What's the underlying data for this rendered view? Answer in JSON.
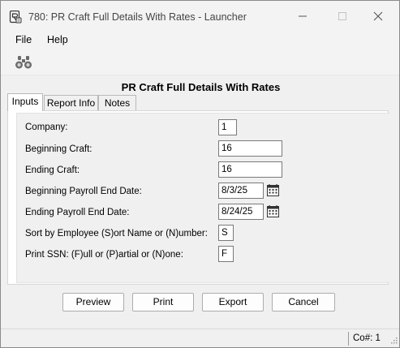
{
  "window": {
    "title": "780: PR Craft Full Details With Rates - Launcher",
    "app_icon": "app-icon"
  },
  "menu": {
    "file": "File",
    "help": "Help"
  },
  "toolbar": {
    "find_icon": "binoculars-icon"
  },
  "form": {
    "title": "PR Craft Full Details With Rates"
  },
  "tabs": [
    {
      "label": "Inputs",
      "active": true
    },
    {
      "label": "Report Info",
      "active": false
    },
    {
      "label": "Notes",
      "active": false
    }
  ],
  "fields": {
    "company": {
      "label": "Company:",
      "value": "1"
    },
    "beginning_craft": {
      "label": "Beginning Craft:",
      "value": "16"
    },
    "ending_craft": {
      "label": "Ending Craft:",
      "value": "16"
    },
    "beginning_payroll_end_date": {
      "label": "Beginning Payroll End Date:",
      "value": "8/3/25"
    },
    "ending_payroll_end_date": {
      "label": "Ending Payroll End Date:",
      "value": "8/24/25"
    },
    "sort_by_employee": {
      "label": "Sort by Employee (S)ort Name or (N)umber:",
      "value": "S"
    },
    "print_ssn": {
      "label": "Print SSN: (F)ull or (P)artial or (N)one:",
      "value": "F"
    }
  },
  "buttons": {
    "preview": "Preview",
    "print": "Print",
    "export": "Export",
    "cancel": "Cancel"
  },
  "status": {
    "company": "Co#: 1"
  }
}
